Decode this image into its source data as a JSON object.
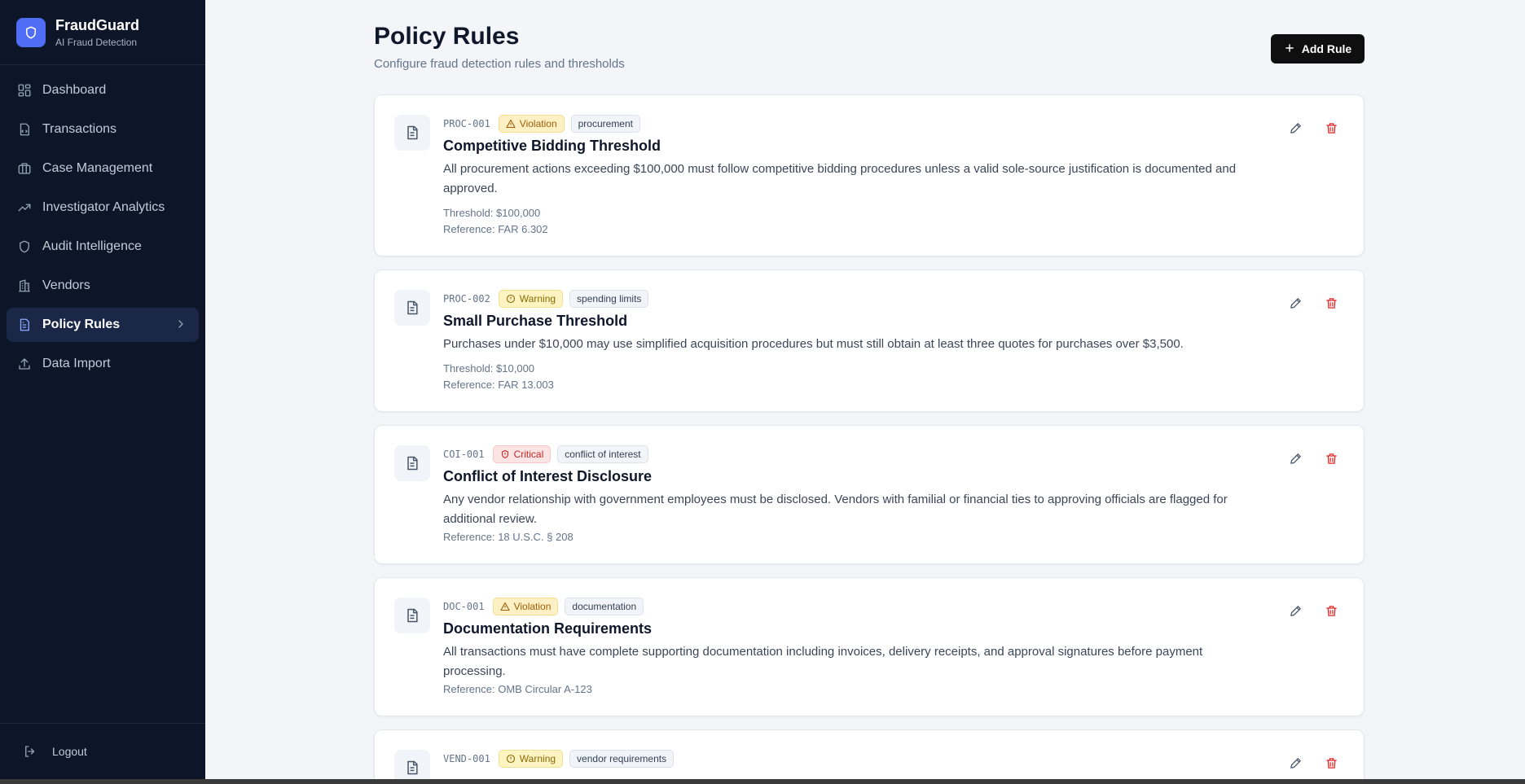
{
  "brand": {
    "name": "FraudGuard",
    "tagline": "AI Fraud Detection",
    "icon": "shield-icon"
  },
  "nav": [
    {
      "label": "Dashboard",
      "icon": "dashboard-icon",
      "active": false
    },
    {
      "label": "Transactions",
      "icon": "transactions-icon",
      "active": false
    },
    {
      "label": "Case Management",
      "icon": "briefcase-icon",
      "active": false
    },
    {
      "label": "Investigator Analytics",
      "icon": "trending-up-icon",
      "active": false
    },
    {
      "label": "Audit Intelligence",
      "icon": "shield-icon",
      "active": false
    },
    {
      "label": "Vendors",
      "icon": "building-icon",
      "active": false
    },
    {
      "label": "Policy Rules",
      "icon": "document-icon",
      "active": true
    },
    {
      "label": "Data Import",
      "icon": "upload-icon",
      "active": false
    }
  ],
  "logout_label": "Logout",
  "page": {
    "title": "Policy Rules",
    "subtitle": "Configure fraud detection rules and thresholds",
    "add_button": "Add Rule"
  },
  "rules": [
    {
      "code": "PROC-001",
      "severity": "Violation",
      "category": "procurement",
      "title": "Competitive Bidding Threshold",
      "description": "All procurement actions exceeding $100,000 must follow competitive bidding procedures unless a valid sole-source justification is documented and approved.",
      "threshold": "Threshold: $100,000",
      "reference": "Reference: FAR 6.302"
    },
    {
      "code": "PROC-002",
      "severity": "Warning",
      "category": "spending limits",
      "title": "Small Purchase Threshold",
      "description": "Purchases under $10,000 may use simplified acquisition procedures but must still obtain at least three quotes for purchases over $3,500.",
      "threshold": "Threshold: $10,000",
      "reference": "Reference: FAR 13.003"
    },
    {
      "code": "COI-001",
      "severity": "Critical",
      "category": "conflict of interest",
      "title": "Conflict of Interest Disclosure",
      "description": "Any vendor relationship with government employees must be disclosed. Vendors with familial or financial ties to approving officials are flagged for additional review.",
      "threshold": "",
      "reference": "Reference: 18 U.S.C. § 208"
    },
    {
      "code": "DOC-001",
      "severity": "Violation",
      "category": "documentation",
      "title": "Documentation Requirements",
      "description": "All transactions must have complete supporting documentation including invoices, delivery receipts, and approval signatures before payment processing.",
      "threshold": "",
      "reference": "Reference: OMB Circular A-123"
    },
    {
      "code": "VEND-001",
      "severity": "Warning",
      "category": "vendor requirements",
      "title": "",
      "description": "",
      "threshold": "",
      "reference": ""
    }
  ],
  "colors": {
    "sidebar_bg": "#0d1628",
    "active_bg": "#1a2747",
    "brand_accent": "#4f6df5",
    "delete_red": "#dc2626"
  }
}
